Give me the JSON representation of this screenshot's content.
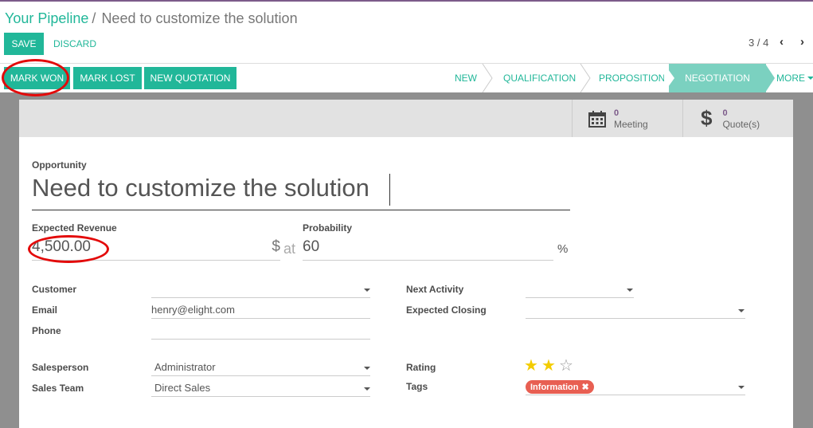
{
  "breadcrumb": {
    "parent": "Your Pipeline",
    "separator": "/",
    "current": "Need to customize the solution"
  },
  "toolbar": {
    "save": "SAVE",
    "discard": "DISCARD"
  },
  "pager": {
    "text": "3 / 4",
    "prev": "‹",
    "next": "›"
  },
  "actions": {
    "mark_won": "MARK WON",
    "mark_lost": "MARK LOST",
    "new_quotation": "NEW QUOTATION"
  },
  "stages": {
    "new": "NEW",
    "qualification": "QUALIFICATION",
    "proposition": "PROPOSITION",
    "negotiation": "NEGOTIATION",
    "more": "MORE"
  },
  "smart_buttons": {
    "meeting": {
      "count": "0",
      "label": "Meeting"
    },
    "quotes": {
      "count": "0",
      "label": "Quote(s)"
    }
  },
  "form": {
    "opportunity_label": "Opportunity",
    "opportunity_value": "Need to customize the solution",
    "expected_revenue_label": "Expected Revenue",
    "expected_revenue_value": "4,500.00",
    "currency_symbol": "$",
    "at_text": "at",
    "probability_label": "Probability",
    "probability_value": "60",
    "percent_symbol": "%",
    "customer_label": "Customer",
    "customer_value": "",
    "email_label": "Email",
    "email_value": "henry@elight.com",
    "phone_label": "Phone",
    "phone_value": "",
    "salesperson_label": "Salesperson",
    "salesperson_value": "Administrator",
    "sales_team_label": "Sales Team",
    "sales_team_value": "Direct Sales",
    "next_activity_label": "Next Activity",
    "next_activity_value": "",
    "expected_closing_label": "Expected Closing",
    "expected_closing_value": "",
    "rating_label": "Rating",
    "rating_value": 2,
    "rating_max": 3,
    "tags_label": "Tags",
    "tags": [
      "Information"
    ]
  },
  "colors": {
    "accent": "#21b799",
    "tag": "#e85f52",
    "star": "#f3cc00",
    "annotation": "#e30a0a"
  },
  "icons": {
    "meeting": "calendar-icon",
    "quotes": "dollar-icon",
    "tag_remove": "close-icon"
  }
}
